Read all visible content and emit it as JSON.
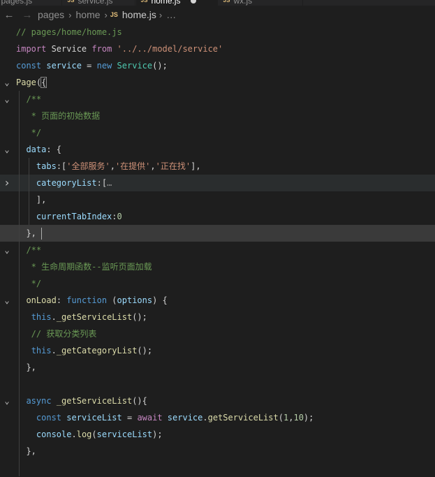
{
  "tabs": [
    {
      "name": "tab-pages-js",
      "label": "pages.js",
      "icon": "js-file-icon",
      "active": false
    },
    {
      "name": "tab-service-js",
      "label": "service.js",
      "icon": "js-file-icon",
      "active": false
    },
    {
      "name": "tab-home-js",
      "label": "home.js",
      "icon": "js-file-icon",
      "active": true,
      "unsaved": true
    },
    {
      "name": "tab-wx-js",
      "label": "wx.js",
      "icon": "js-file-icon",
      "active": false
    }
  ],
  "breadcrumb": {
    "back_icon": "arrow-left-icon",
    "forward_icon": "arrow-right-icon",
    "parts": [
      "pages",
      "home"
    ],
    "file": "home.js",
    "more": "…"
  },
  "lines": [
    {
      "tokens": [
        [
          "com",
          "// pages/home/home.js"
        ]
      ]
    },
    {
      "tokens": [
        [
          "kw2",
          "import"
        ],
        [
          "plain",
          " Service "
        ],
        [
          "kw2",
          "from"
        ],
        [
          "plain",
          " "
        ],
        [
          "str",
          "'../../model/service'"
        ]
      ]
    },
    {
      "tokens": [
        [
          "key",
          "const"
        ],
        [
          "plain",
          " "
        ],
        [
          "var",
          "service"
        ],
        [
          "plain",
          " = "
        ],
        [
          "key",
          "new"
        ],
        [
          "plain",
          " "
        ],
        [
          "cls",
          "Service"
        ],
        [
          "plain",
          "();"
        ]
      ]
    },
    {
      "fold": "open",
      "tokens": [
        [
          "fn",
          "Page"
        ],
        [
          "plain",
          "("
        ],
        [
          "plain",
          "{"
        ]
      ]
    },
    {
      "fold": "open",
      "tokens": [
        [
          "com",
          "  /**"
        ]
      ]
    },
    {
      "tokens": [
        [
          "com",
          "   * 页面的初始数据"
        ]
      ]
    },
    {
      "tokens": [
        [
          "com",
          "   */"
        ]
      ]
    },
    {
      "fold": "open",
      "tokens": [
        [
          "plain",
          "  "
        ],
        [
          "var",
          "data"
        ],
        [
          "plain",
          ": {"
        ]
      ]
    },
    {
      "tokens": [
        [
          "plain",
          "    "
        ],
        [
          "var",
          "tabs"
        ],
        [
          "plain",
          ":["
        ],
        [
          "str",
          "'全部服务'"
        ],
        [
          "plain",
          ","
        ],
        [
          "str",
          "'在提供'"
        ],
        [
          "plain",
          ","
        ],
        [
          "str",
          "'正在找'"
        ],
        [
          "plain",
          "],"
        ]
      ]
    },
    {
      "fold": "closed",
      "highlight": true,
      "tokens": [
        [
          "plain",
          "    "
        ],
        [
          "var",
          "categoryList"
        ],
        [
          "plain",
          ":["
        ],
        [
          "ellip",
          "…"
        ]
      ]
    },
    {
      "tokens": [
        [
          "plain",
          "    ],"
        ]
      ]
    },
    {
      "tokens": [
        [
          "plain",
          "    "
        ],
        [
          "var",
          "currentTabIndex"
        ],
        [
          "plain",
          ":"
        ],
        [
          "num",
          "0"
        ]
      ]
    },
    {
      "current": true,
      "tokens": [
        [
          "plain",
          "  },"
        ]
      ]
    },
    {
      "fold": "open",
      "tokens": [
        [
          "com",
          "  /**"
        ]
      ]
    },
    {
      "tokens": [
        [
          "com",
          "   * 生命周期函数--监听页面加载"
        ]
      ]
    },
    {
      "tokens": [
        [
          "com",
          "   */"
        ]
      ]
    },
    {
      "fold": "open",
      "tokens": [
        [
          "plain",
          "  "
        ],
        [
          "fn",
          "onLoad"
        ],
        [
          "plain",
          ": "
        ],
        [
          "key",
          "function"
        ],
        [
          "plain",
          " ("
        ],
        [
          "prm",
          "options"
        ],
        [
          "plain",
          ") {"
        ]
      ]
    },
    {
      "tokens": [
        [
          "plain",
          "   "
        ],
        [
          "key",
          "this"
        ],
        [
          "plain",
          "."
        ],
        [
          "fn",
          "_getServiceList"
        ],
        [
          "plain",
          "();"
        ]
      ]
    },
    {
      "tokens": [
        [
          "com",
          "   // 获取分类列表"
        ]
      ]
    },
    {
      "tokens": [
        [
          "plain",
          "   "
        ],
        [
          "key",
          "this"
        ],
        [
          "plain",
          "."
        ],
        [
          "fn",
          "_getCategoryList"
        ],
        [
          "plain",
          "();"
        ]
      ]
    },
    {
      "tokens": [
        [
          "plain",
          "  },"
        ]
      ]
    },
    {
      "tokens": []
    },
    {
      "fold": "open",
      "tokens": [
        [
          "plain",
          "  "
        ],
        [
          "key",
          "async"
        ],
        [
          "plain",
          " "
        ],
        [
          "fn",
          "_getServiceList"
        ],
        [
          "plain",
          "(){"
        ]
      ]
    },
    {
      "tokens": [
        [
          "plain",
          "    "
        ],
        [
          "key",
          "const"
        ],
        [
          "plain",
          " "
        ],
        [
          "var",
          "serviceList"
        ],
        [
          "plain",
          " = "
        ],
        [
          "kw2",
          "await"
        ],
        [
          "plain",
          " "
        ],
        [
          "var",
          "service"
        ],
        [
          "plain",
          "."
        ],
        [
          "fn",
          "getServiceList"
        ],
        [
          "plain",
          "("
        ],
        [
          "num",
          "1"
        ],
        [
          "plain",
          ","
        ],
        [
          "num",
          "10"
        ],
        [
          "plain",
          ");"
        ]
      ]
    },
    {
      "tokens": [
        [
          "plain",
          "    "
        ],
        [
          "var",
          "console"
        ],
        [
          "plain",
          "."
        ],
        [
          "fn",
          "log"
        ],
        [
          "plain",
          "("
        ],
        [
          "var",
          "serviceList"
        ],
        [
          "plain",
          ");"
        ]
      ]
    },
    {
      "tokens": [
        [
          "plain",
          "  },"
        ]
      ]
    },
    {
      "tokens": []
    }
  ]
}
